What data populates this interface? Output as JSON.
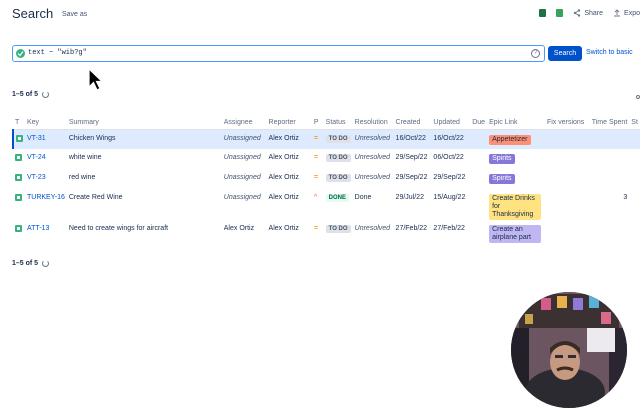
{
  "header": {
    "title": "Search",
    "save_as": "Save as",
    "share": "Share",
    "export": "Expo"
  },
  "search": {
    "query": "text ~ \"wib?g\"",
    "button": "Search",
    "switch": "Switch to basic"
  },
  "pagination": {
    "top": "1–5 of 5",
    "bottom": "1–5 of 5"
  },
  "table": {
    "headers": [
      "T",
      "Key",
      "Summary",
      "Assignee",
      "Reporter",
      "P",
      "Status",
      "Resolution",
      "Created",
      "Updated",
      "Due",
      "Epic Link",
      "Fix versions",
      "Time Spent",
      "St"
    ],
    "rows": [
      {
        "key": "VT-31",
        "summary": "Chicken Wings",
        "assignee": "Unassigned",
        "reporter": "Alex Ortiz",
        "status": "TO DO",
        "resolution": "Unresolved",
        "created": "16/Oct/22",
        "updated": "16/Oct/22",
        "epic": "Appetetizer",
        "time_spent": ""
      },
      {
        "key": "VT-24",
        "summary": "white wine",
        "assignee": "Unassigned",
        "reporter": "Alex Ortiz",
        "status": "TO DO",
        "resolution": "Unresolved",
        "created": "29/Sep/22",
        "updated": "06/Oct/22",
        "epic": "Spirits",
        "time_spent": ""
      },
      {
        "key": "VT-23",
        "summary": "red wine",
        "assignee": "Unassigned",
        "reporter": "Alex Ortiz",
        "status": "TO DO",
        "resolution": "Unresolved",
        "created": "29/Sep/22",
        "updated": "29/Sep/22",
        "epic": "Spirits",
        "time_spent": ""
      },
      {
        "key": "TURKEY-16",
        "summary": "Create Red Wine",
        "assignee": "Unassigned",
        "reporter": "Alex Ortiz",
        "status": "DONE",
        "resolution": "Done",
        "created": "29/Jul/22",
        "updated": "15/Aug/22",
        "epic": "Create Drinks for Thanksgiving",
        "time_spent": "3"
      },
      {
        "key": "ATT-13",
        "summary": "Need to create wings for aircraft",
        "assignee": "Alex Ortiz",
        "reporter": "Alex Ortiz",
        "status": "TO DO",
        "resolution": "Unresolved",
        "created": "27/Feb/22",
        "updated": "27/Feb/22",
        "epic": "Create an airplane part",
        "time_spent": ""
      }
    ]
  },
  "colors": {
    "accent": "#0052cc",
    "story": "#36b37e",
    "priority_medium": "#ff991f"
  }
}
